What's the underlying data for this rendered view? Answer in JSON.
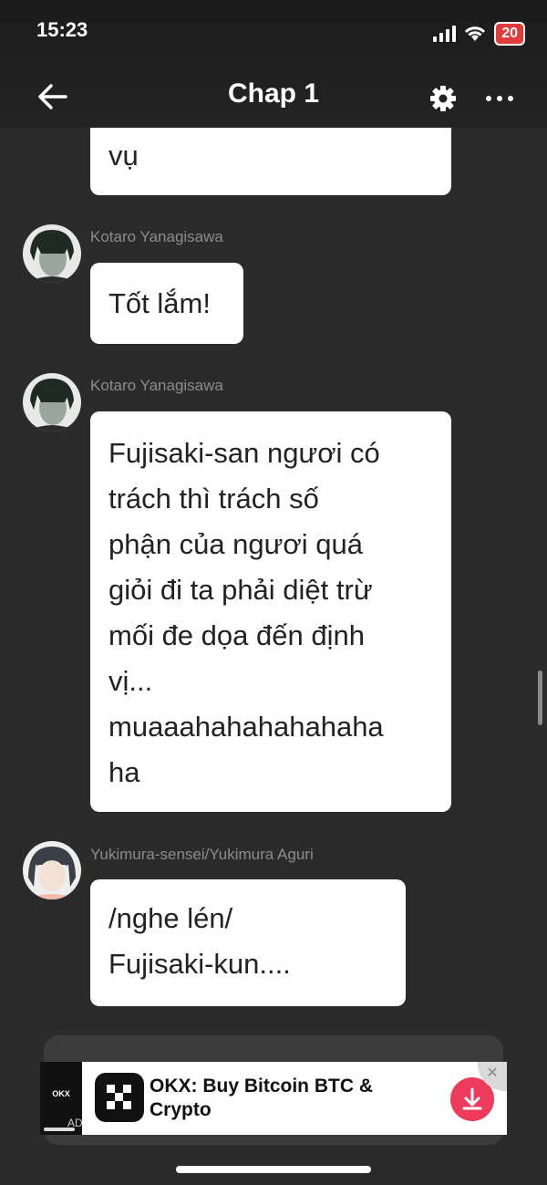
{
  "status_bar": {
    "time": "15:23",
    "battery": "20"
  },
  "nav": {
    "title": "Chap 1",
    "back_icon": "arrow-left-icon",
    "settings_icon": "gear-icon",
    "more_icon": "more-horizontal-icon"
  },
  "messages": [
    {
      "text": "vụ"
    },
    {
      "sender": "Kotaro Yanagisawa",
      "text": "Tốt lắm!"
    },
    {
      "sender": "Kotaro Yanagisawa",
      "lines": [
        "Fujisaki-san ngươi có",
        "trách thì trách số",
        "phận của ngươi quá",
        "giỏi đi ta phải diệt trừ",
        "mối đe dọa đến định",
        "vị...",
        "muaaahahahahahaha",
        "ha"
      ]
    },
    {
      "sender": "Yukimura-sensei/Yukimura Aguri",
      "lines": [
        "/nghe lén/",
        "Fujisaki-kun...."
      ]
    }
  ],
  "ad": {
    "title": "OKX: Buy Bitcoin BTC & Crypto",
    "label": "AD",
    "close": "✕",
    "brand_color": "#ee3a5b"
  }
}
